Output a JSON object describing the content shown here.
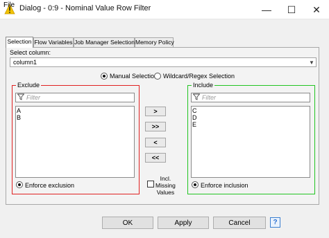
{
  "window": {
    "title": "Dialog - 0:9 - Nominal Value Row Filter",
    "minimize": "—",
    "maximize": "☐",
    "close": "✕",
    "icon": "warning-triangle-icon"
  },
  "menu": {
    "file": "File"
  },
  "tabs": [
    {
      "label": "Selection",
      "active": true
    },
    {
      "label": "Flow Variables"
    },
    {
      "label": "Job Manager Selection"
    },
    {
      "label": "Memory Policy"
    }
  ],
  "selection": {
    "select_column_label": "Select column:",
    "selected_column": "column1",
    "manual_label": "Manual Selection",
    "wildcard_label": "Wildcard/Regex Selection",
    "mode": "manual"
  },
  "exclude": {
    "title": "Exclude",
    "filter_placeholder": "Filter",
    "items": [
      "A",
      "B"
    ],
    "enforce_label": "Enforce exclusion"
  },
  "include": {
    "title": "Include",
    "filter_placeholder": "Filter",
    "items": [
      "C",
      "D",
      "E"
    ],
    "enforce_label": "Enforce inclusion"
  },
  "move_buttons": {
    "add": ">",
    "add_all": ">>",
    "remove": "<",
    "remove_all": "<<"
  },
  "missing": {
    "label_line1": "Incl.",
    "label_line2": "Missing",
    "label_line3": "Values"
  },
  "buttons": {
    "ok": "OK",
    "apply": "Apply",
    "cancel": "Cancel",
    "help": "?"
  },
  "colors": {
    "exclude_border": "#e02020",
    "include_border": "#21c421"
  }
}
